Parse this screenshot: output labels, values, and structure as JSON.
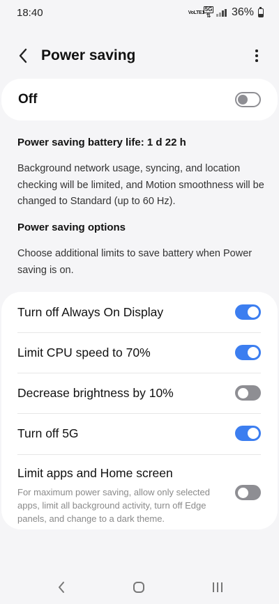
{
  "status_bar": {
    "time": "18:40",
    "volte_label": "VoLTE1",
    "network_label": "5G",
    "battery_percent": "36%",
    "battery_level": 0.36,
    "icons": [
      "volte-icon",
      "5g-icon",
      "signal-icon",
      "battery-icon"
    ]
  },
  "app_bar": {
    "title": "Power saving",
    "back_icon": "chevron-left-icon",
    "more_icon": "more-vertical-icon"
  },
  "master": {
    "label": "Off",
    "enabled": false
  },
  "info": {
    "battery_life": "Power saving battery life: 1 d 22 h",
    "description": "Background network usage, syncing, and location checking will be limited, and Motion smoothness will be changed to Standard (up to 60 Hz).",
    "options_heading": "Power saving options",
    "options_description": "Choose additional limits to save battery when Power saving is on."
  },
  "options": [
    {
      "label": "Turn off Always On Display",
      "enabled": true
    },
    {
      "label": "Limit CPU speed to 70%",
      "enabled": true
    },
    {
      "label": "Decrease brightness by 10%",
      "enabled": false
    },
    {
      "label": "Turn off 5G",
      "enabled": true
    },
    {
      "label": "Limit apps and Home screen",
      "sublabel": "For maximum power saving, allow only selected apps, limit all background activity, turn off Edge panels, and change to a dark theme.",
      "enabled": false
    }
  ],
  "nav_bar": {
    "icons": [
      "back-nav-icon",
      "home-nav-icon",
      "recents-nav-icon"
    ]
  },
  "colors": {
    "accent": "#3c7ef0",
    "background": "#f5f5f7",
    "card": "#ffffff",
    "toggle_off": "#8e8e93"
  }
}
